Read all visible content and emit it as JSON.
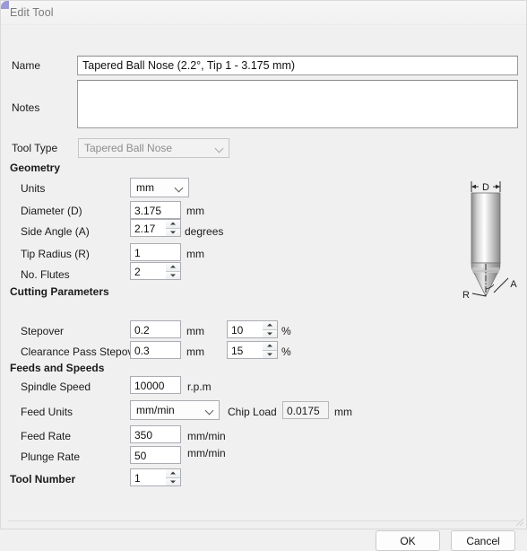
{
  "window": {
    "title": "Edit Tool"
  },
  "fields": {
    "name_label": "Name",
    "name_value": "Tapered Ball Nose (2.2°, Tip 1 - 3.175 mm)",
    "notes_label": "Notes",
    "notes_value": "",
    "tool_type_label": "Tool Type",
    "tool_type_value": "Tapered Ball Nose"
  },
  "geometry": {
    "heading": "Geometry",
    "units_label": "Units",
    "units_value": "mm",
    "diameter_label": "Diameter (D)",
    "diameter_value": "3.175",
    "diameter_unit": "mm",
    "side_angle_label": "Side Angle (A)",
    "side_angle_value": "2.17",
    "side_angle_unit": "degrees",
    "tip_radius_label": "Tip Radius (R)",
    "tip_radius_value": "1",
    "tip_radius_unit": "mm",
    "flutes_label": "No. Flutes",
    "flutes_value": "2"
  },
  "cutting": {
    "heading": "Cutting Parameters",
    "stepover_label": "Stepover",
    "stepover_value": "0.2",
    "stepover_unit": "mm",
    "stepover_pct": "10",
    "stepover_pct_unit": "%",
    "clearance_label": "Clearance Pass Stepover",
    "clearance_value": "0.3",
    "clearance_unit": "mm",
    "clearance_pct": "15",
    "clearance_pct_unit": "%"
  },
  "feeds": {
    "heading": "Feeds and Speeds",
    "spindle_label": "Spindle Speed",
    "spindle_value": "10000",
    "spindle_unit": "r.p.m",
    "feed_units_label": "Feed Units",
    "feed_units_value": "mm/min",
    "chip_load_label": "Chip Load",
    "chip_load_value": "0.0175",
    "chip_load_unit": "mm",
    "feed_rate_label": "Feed Rate",
    "feed_rate_value": "350",
    "feed_rate_unit": "mm/min",
    "plunge_label": "Plunge Rate",
    "plunge_value": "50",
    "plunge_unit": "mm/min"
  },
  "tool_number": {
    "label": "Tool Number",
    "value": "1"
  },
  "diagram": {
    "diameter_mark": "D",
    "radius_mark": "R",
    "angle_mark": "A"
  },
  "footer": {
    "ok_label": "OK",
    "cancel_label": "Cancel"
  },
  "colors": {
    "dialog_bg": "#f0f0f0",
    "field_bg": "#ffffff",
    "field_border": "#abadb3",
    "title_text": "#7a7a7a",
    "text": "#1a1a1a"
  }
}
